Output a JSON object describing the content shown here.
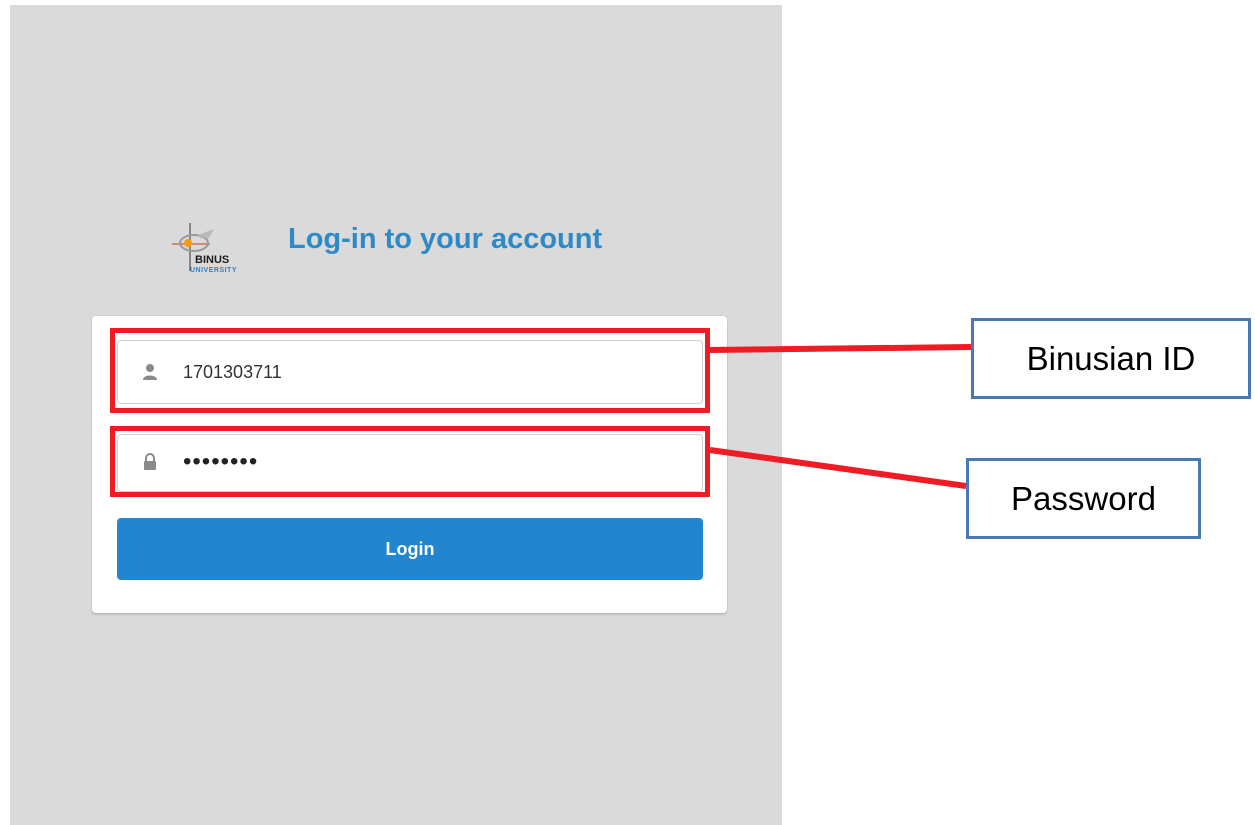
{
  "page": {
    "title": "Log-in to your account",
    "logo": {
      "name": "BINUS",
      "sub": "UNIVERSITY"
    }
  },
  "form": {
    "username": {
      "value": "1701303711",
      "icon": "user-icon"
    },
    "password": {
      "value": "••••••••",
      "icon": "lock-icon"
    },
    "login_label": "Login"
  },
  "annotations": {
    "binusian_id": "Binusian ID",
    "password": "Password"
  },
  "colors": {
    "background": "#dadada",
    "title": "#2d8ac7",
    "button": "#2185d0",
    "highlight": "#ee1c25",
    "callout_border": "#4a78b5"
  }
}
